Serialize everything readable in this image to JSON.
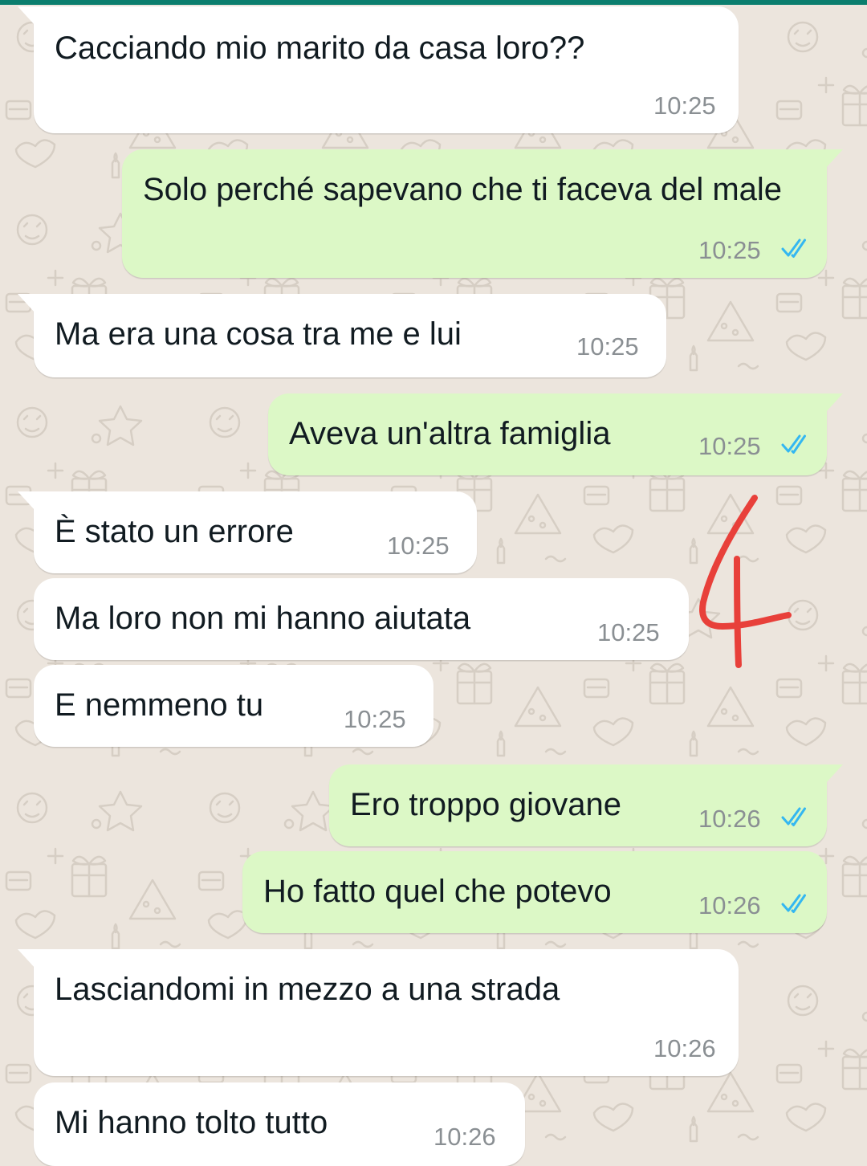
{
  "theme": {
    "header_color": "#0b7e6e",
    "wallpaper_color": "#ece5dd",
    "incoming_bubble": "#ffffff",
    "outgoing_bubble": "#dcf8c6",
    "tick_color": "#34b7f1",
    "annotation_color": "#e8403a"
  },
  "messages": [
    {
      "direction": "incoming",
      "text": "Cacciando mio marito da casa loro??",
      "time": "10:25"
    },
    {
      "direction": "outgoing",
      "text": "Solo perché sapevano che ti faceva del male",
      "time": "10:25",
      "status": "read"
    },
    {
      "direction": "incoming",
      "text": "Ma era una cosa tra me e lui",
      "time": "10:25"
    },
    {
      "direction": "outgoing",
      "text": "Aveva un'altra famiglia",
      "time": "10:25",
      "status": "read"
    },
    {
      "direction": "incoming",
      "text": "È stato un errore",
      "time": "10:25"
    },
    {
      "direction": "incoming",
      "text": "Ma loro non mi hanno aiutata",
      "time": "10:25"
    },
    {
      "direction": "incoming",
      "text": "E nemmeno tu",
      "time": "10:25"
    },
    {
      "direction": "outgoing",
      "text": "Ero troppo giovane",
      "time": "10:26",
      "status": "read"
    },
    {
      "direction": "outgoing",
      "text": "Ho fatto quel che potevo",
      "time": "10:26",
      "status": "read"
    },
    {
      "direction": "incoming",
      "text": "Lasciandomi in mezzo a una strada",
      "time": "10:26"
    },
    {
      "direction": "incoming",
      "text": "Mi hanno tolto tutto",
      "time": "10:26"
    }
  ],
  "annotation": {
    "type": "handwritten-number",
    "text": "4"
  }
}
